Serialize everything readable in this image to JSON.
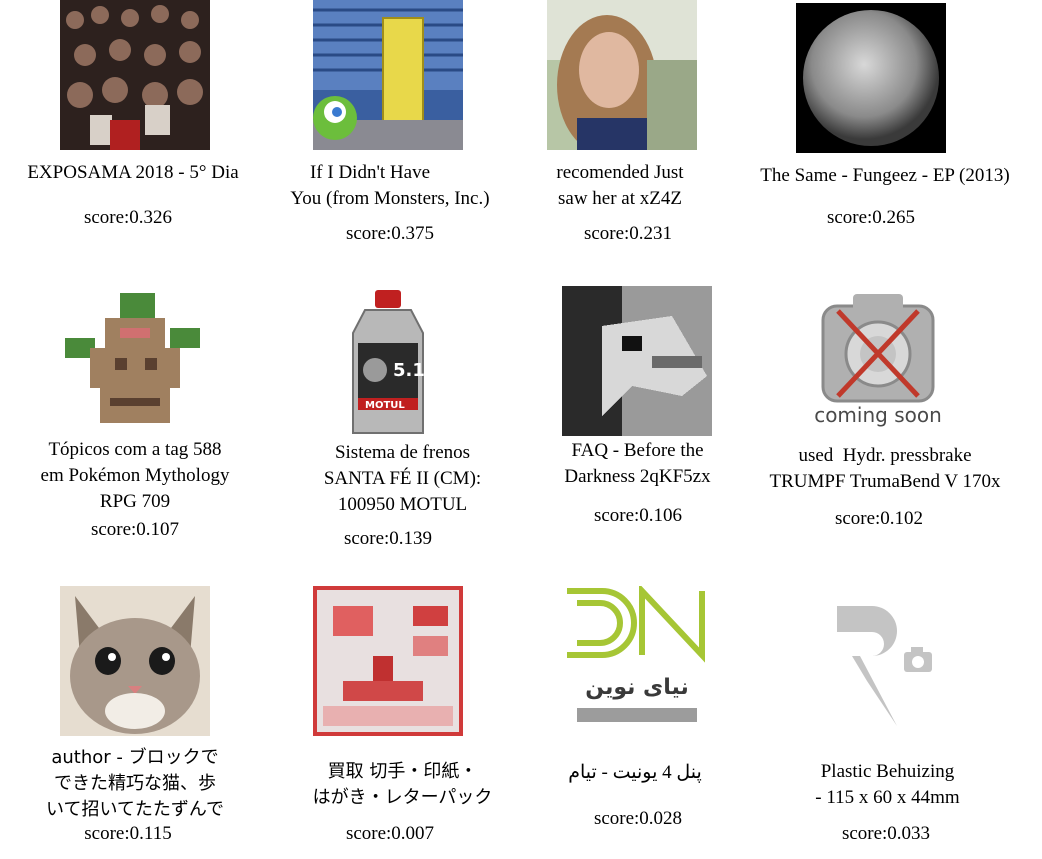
{
  "items": [
    {
      "caption_lines": [
        "EXPOSAMA 2018 - 5° Dia"
      ],
      "score": "score:0.326",
      "image": "crowd-photo"
    },
    {
      "caption_lines": [
        "If I Didn't Have",
        "You (from Monsters, Inc.)"
      ],
      "score": "score:0.375",
      "image": "monsters-inc-still"
    },
    {
      "caption_lines": [
        "recomended Just",
        "saw her at xZ4Z"
      ],
      "score": "score:0.231",
      "image": "blurred-portrait"
    },
    {
      "caption_lines": [
        "The Same - Fungeez - EP (2013)"
      ],
      "score": "score:0.265",
      "image": "grey-sphere"
    },
    {
      "caption_lines": [
        "Tópicos com a tag 588",
        "em Pokémon Mythology",
        "RPG 709"
      ],
      "score": "score:0.107",
      "image": "pixel-tree-sprite"
    },
    {
      "caption_lines": [
        "Sistema de frenos",
        "SANTA FÉ II (CM):",
        "100950 MOTUL"
      ],
      "score": "score:0.139",
      "image": "motul-brake-fluid"
    },
    {
      "caption_lines": [
        "FAQ - Before the",
        "Darkness 2qKF5zx"
      ],
      "score": "score:0.106",
      "image": "pixelated-creature"
    },
    {
      "caption_lines": [
        "used  Hydr. pressbrake",
        "TRUMPF TrumaBend V 170x"
      ],
      "score": "score:0.102",
      "image": "coming-soon-camera",
      "image_text": "coming soon"
    },
    {
      "caption_lines": [
        "author - ブロックで",
        "できた精巧な猫、歩",
        "いて招いてたたずんで"
      ],
      "score": "score:0.115",
      "image": "kitten-photo"
    },
    {
      "caption_lines": [
        "買取 切手・印紙・",
        "はがき・レターパック"
      ],
      "score": "score:0.007",
      "image": "red-pixel-icon"
    },
    {
      "caption_lines": [
        "پنل 4 یونیت - تیام"
      ],
      "score": "score:0.028",
      "image": "dn-logo",
      "image_text": "نیای نوین"
    },
    {
      "caption_lines": [
        "Plastic Behuizing",
        "- 115 x 60 x 44mm"
      ],
      "score": "score:0.033",
      "image": "placeholder-logo"
    }
  ]
}
